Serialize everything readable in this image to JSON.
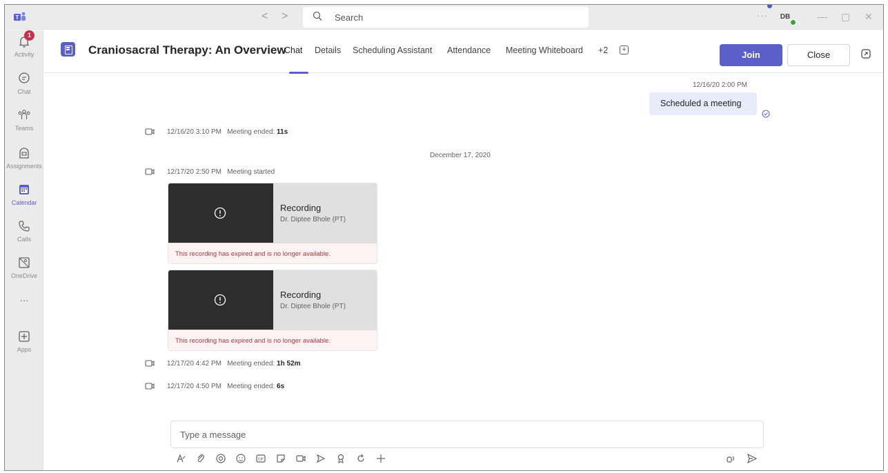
{
  "titlebar": {
    "search_placeholder": "Search",
    "more_label": "···",
    "avatar_initials": "DB",
    "minimize": "—",
    "restore": "▢",
    "close": "✕",
    "back": "<",
    "forward": ">"
  },
  "rail": {
    "items": [
      {
        "label": "Activity",
        "icon": "bell-icon",
        "badge": "1"
      },
      {
        "label": "Chat",
        "icon": "chat-icon"
      },
      {
        "label": "Teams",
        "icon": "teams-icon"
      },
      {
        "label": "Assignments",
        "icon": "assignments-icon"
      },
      {
        "label": "Calendar",
        "icon": "calendar-icon",
        "active": true
      },
      {
        "label": "Calls",
        "icon": "phone-icon"
      },
      {
        "label": "OneDrive",
        "icon": "onedrive-icon"
      },
      {
        "label": "···",
        "icon": "more-icon"
      },
      {
        "label": "Apps",
        "icon": "apps-icon"
      }
    ]
  },
  "header": {
    "title": "Craniosacral Therapy: An Overview",
    "tabs": [
      "Chat",
      "Details",
      "Scheduling Assistant",
      "Attendance",
      "Meeting Whiteboard",
      "+2"
    ],
    "join_label": "Join",
    "close_label": "Close",
    "accent_color": "#5b5fc7"
  },
  "chat": {
    "sent_timestamp": "12/16/20 2:00 PM",
    "sent_message": "Scheduled a meeting",
    "events": [
      {
        "time": "12/16/20 3:10 PM",
        "text": "Meeting ended: ",
        "bold": "11s"
      },
      {
        "time": "12/17/20 2:50 PM",
        "text": "Meeting started",
        "bold": ""
      },
      {
        "time": "12/17/20 4:42 PM",
        "text": "Meeting ended: ",
        "bold": "1h 52m"
      },
      {
        "time": "12/17/20 4:50 PM",
        "text": "Meeting ended: ",
        "bold": "6s"
      }
    ],
    "date_separator": "December 17, 2020",
    "recordings": [
      {
        "title": "Recording",
        "owner": "Dr. Diptee Bhole (PT)",
        "status": "This recording has expired and is no longer available."
      },
      {
        "title": "Recording",
        "owner": "Dr. Diptee Bhole (PT)",
        "status": "This recording has expired and is no longer available."
      }
    ]
  },
  "composer": {
    "placeholder": "Type a message",
    "tools": [
      "format-icon",
      "attach-icon",
      "loop-icon",
      "emoji-icon",
      "gif-icon",
      "sticker-icon",
      "meet-now-icon",
      "send-later-icon",
      "praise-icon",
      "refresh-icon",
      "add-icon"
    ],
    "right_tools": [
      "audio-message-icon",
      "send-icon"
    ]
  }
}
